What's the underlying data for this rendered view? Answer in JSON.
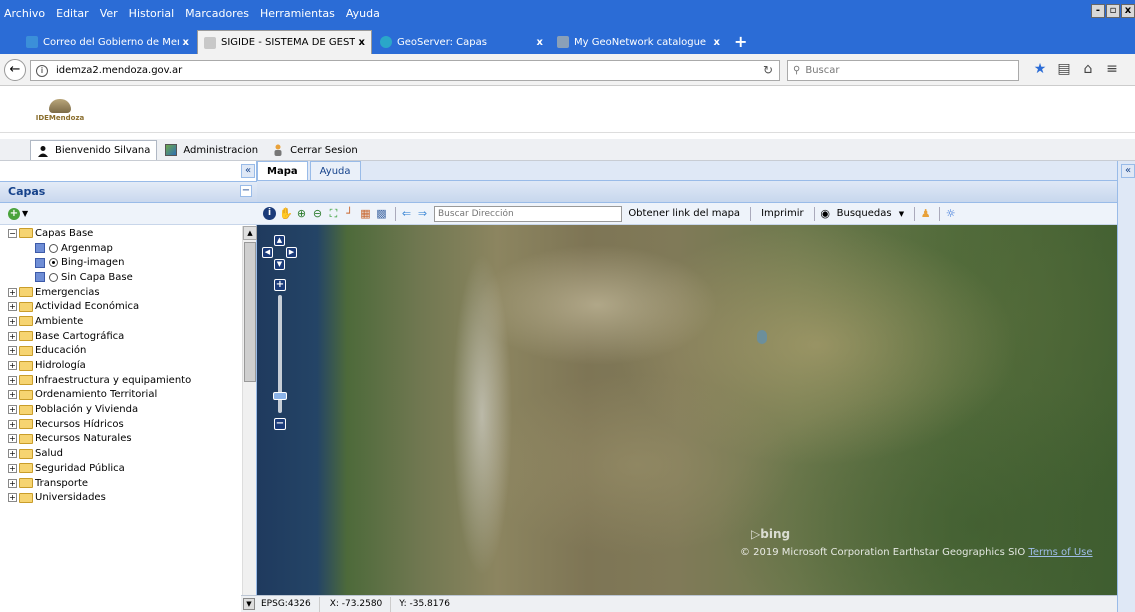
{
  "browser": {
    "menu": [
      "Archivo",
      "Editar",
      "Ver",
      "Historial",
      "Marcadores",
      "Herramientas",
      "Ayuda"
    ],
    "window_buttons": [
      "-",
      "▫",
      "x"
    ],
    "tabs": [
      {
        "label": "Correo del Gobierno de Mend...",
        "close": "x",
        "favicon_color": "#3b8fd9"
      },
      {
        "label": "SIGIDE - SISTEMA DE GESTIO...",
        "close": "x",
        "favicon_color": "#c8c8c8"
      },
      {
        "label": "GeoServer: Capas",
        "close": "x",
        "favicon_color": "#2aa7c9"
      },
      {
        "label": "My GeoNetwork catalogue",
        "close": "x",
        "favicon_color": "#8aa0b8"
      }
    ],
    "new_tab": "+",
    "url": "idemza2.mendoza.gov.ar",
    "search_placeholder": "Buscar"
  },
  "header": {
    "logo_text": "IDEMendoza"
  },
  "userbar": {
    "welcome": "Bienvenido Silvana",
    "admin": "Administracion",
    "logout": "Cerrar Sesion"
  },
  "layers_panel": {
    "title": "Capas",
    "collapse": "«",
    "tree": {
      "base": {
        "label": "Capas Base",
        "children": [
          {
            "label": "Argenmap",
            "selected": false
          },
          {
            "label": "Bing-imagen",
            "selected": true
          },
          {
            "label": "Sin Capa Base",
            "selected": false
          }
        ]
      },
      "folders": [
        "Emergencias",
        "Actividad Económica",
        "Ambiente",
        "Base Cartográfica",
        "Educación",
        "Hidrología",
        "Infraestructura y equipamiento",
        "Ordenamiento Territorial",
        "Población y Vivienda",
        "Recursos Hídricos",
        "Recursos Naturales",
        "Salud",
        "Seguridad Pública",
        "Transporte",
        "Universidades"
      ]
    }
  },
  "map_panel": {
    "tabs": [
      {
        "label": "Mapa",
        "active": true
      },
      {
        "label": "Ayuda",
        "active": false
      }
    ],
    "toolbar": {
      "address_placeholder": "Buscar Dirección",
      "link_label": "Obtener link del mapa",
      "print_label": "Imprimir",
      "search_label": "Busquedas"
    },
    "zoom_level": 0.86,
    "bing_logo": "bing",
    "attribution": "© 2019 Microsoft Corporation Earthstar Geographics SIO",
    "terms": "Terms of Use"
  },
  "status": {
    "projection": "EPSG:4326",
    "x": "X: -73.2580",
    "y": "Y: -35.8176"
  }
}
